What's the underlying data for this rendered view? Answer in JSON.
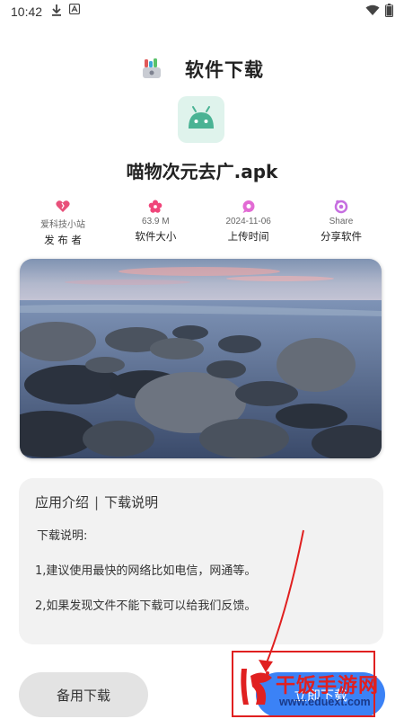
{
  "status_bar": {
    "time": "10:42",
    "icons": [
      "download-icon",
      "notification-a-icon",
      "wifi-icon",
      "battery-icon"
    ]
  },
  "header": {
    "title": "软件下载",
    "logo_icon": "app-store-icon"
  },
  "app": {
    "icon": "android-icon",
    "file_name": "喵物次元去广.apk"
  },
  "info": [
    {
      "value": "爱科技小站",
      "label": "发 布 者",
      "icon": "heart-icon",
      "color": "#e8507a"
    },
    {
      "value": "63.9 M",
      "label": "软件大小",
      "icon": "flower-icon",
      "color": "#f0457a"
    },
    {
      "value": "2024-11-06",
      "label": "上传时间",
      "icon": "chat-bubble-icon",
      "color": "#e26bd4"
    },
    {
      "value": "Share",
      "label": "分享软件",
      "icon": "share-icon",
      "color": "#c66ee0"
    }
  ],
  "description": {
    "tab_intro": "应用介绍",
    "separator": "|",
    "tab_download": "下载说明",
    "heading": "下载说明:",
    "lines": [
      "1,建议使用最快的网络比如电信，网通等。",
      "2,如果发现文件不能下载可以给我们反馈。"
    ]
  },
  "buttons": {
    "backup_download": "备用下载",
    "download": "立即下载"
  },
  "watermark": {
    "title": "干饭手游网",
    "url": "www.eduext.com",
    "color": "#e02020"
  }
}
